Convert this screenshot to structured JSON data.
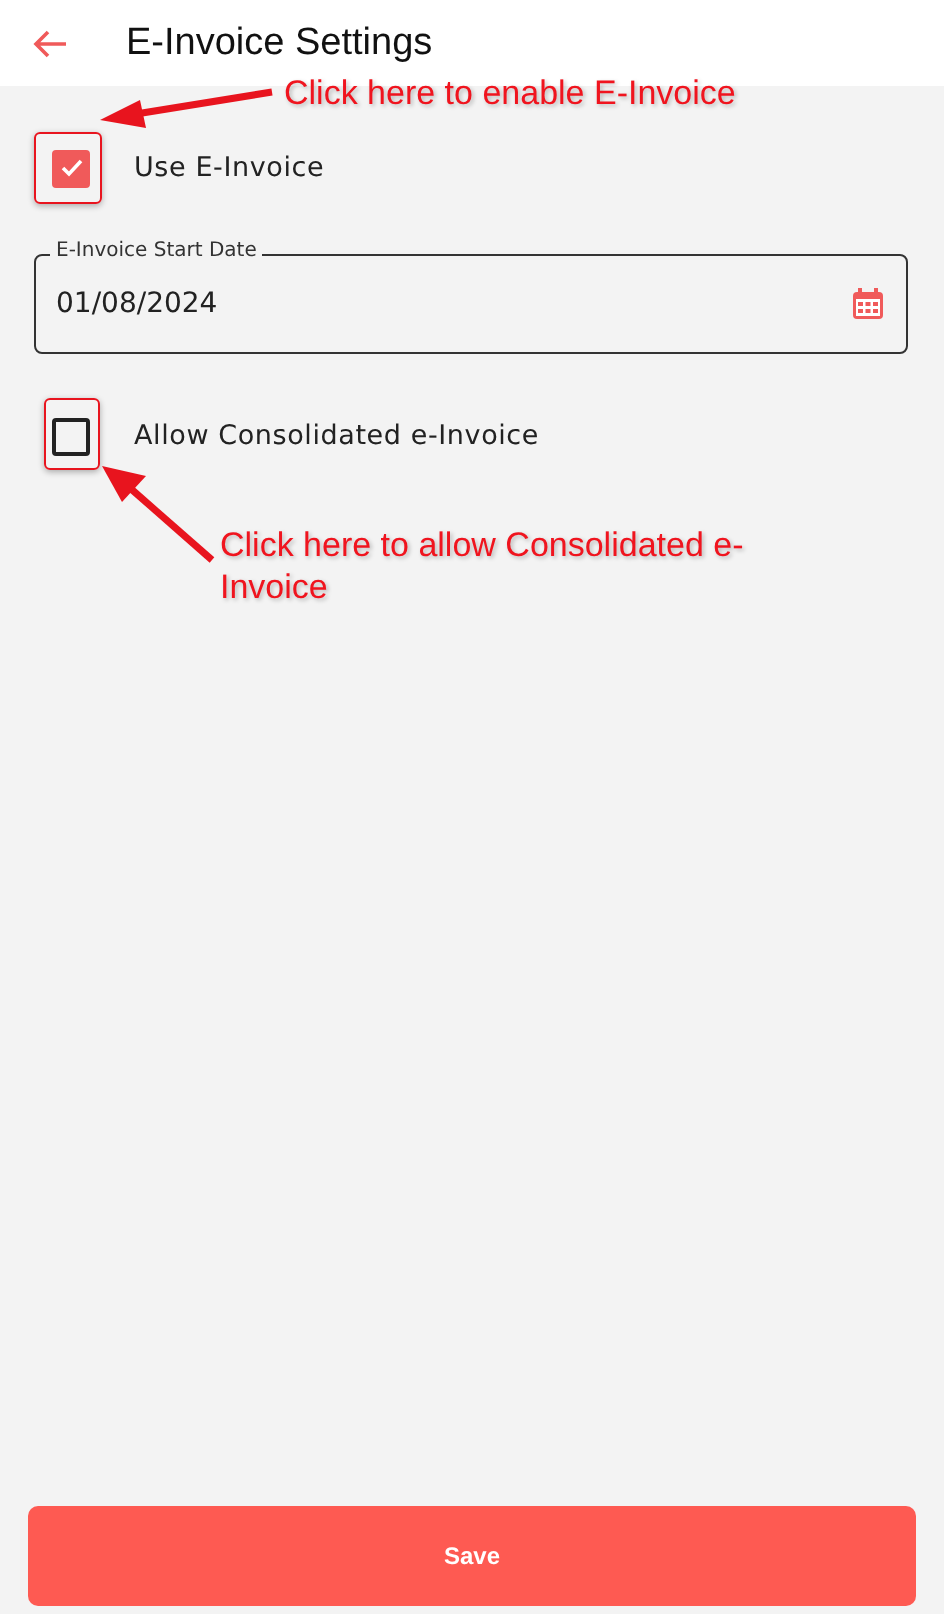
{
  "header": {
    "title": "E-Invoice Settings"
  },
  "use_einvoice": {
    "label": "Use E-Invoice",
    "checked": true
  },
  "start_date": {
    "label": "E-Invoice Start Date",
    "value": "01/08/2024"
  },
  "allow_consolidated": {
    "label": "Allow Consolidated e-Invoice",
    "checked": false
  },
  "annotations": [
    {
      "text": "Click here to enable E-Invoice"
    },
    {
      "text": "Click here to allow Consolidated e-Invoice"
    }
  ],
  "save_button": {
    "label": "Save"
  }
}
